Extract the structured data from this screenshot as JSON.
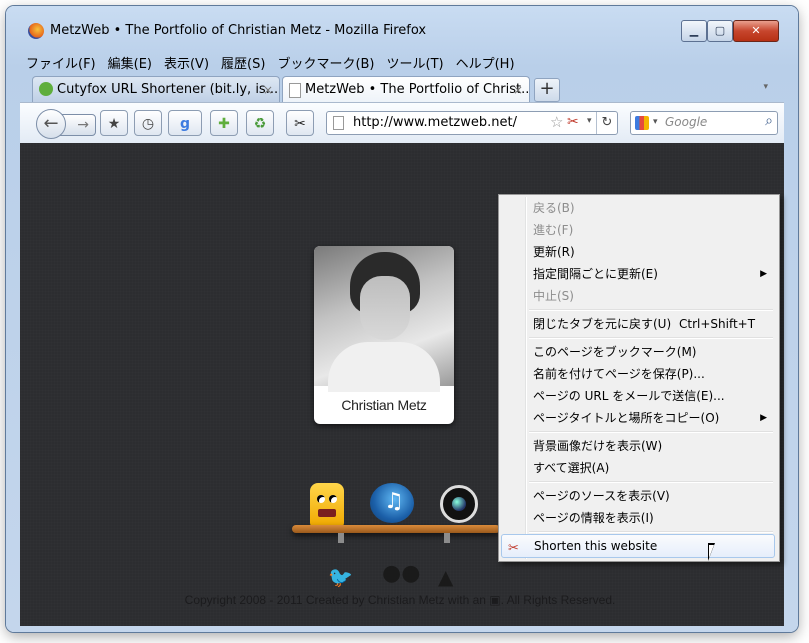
{
  "window": {
    "title": "MetzWeb • The Portfolio of Christian Metz - Mozilla Firefox",
    "min": "▁",
    "max": "▢",
    "close": "✕"
  },
  "menubar": [
    "ファイル(F)",
    "編集(E)",
    "表示(V)",
    "履歴(S)",
    "ブックマーク(B)",
    "ツール(T)",
    "ヘルプ(H)"
  ],
  "tabs": [
    {
      "label": "Cutyfox URL Shortener (bit.ly, is....",
      "close": "×"
    },
    {
      "label": "MetzWeb • The Portfolio of Christ...",
      "close": "×"
    }
  ],
  "newtab": "+",
  "tabs_list": "▾",
  "toolbar": {
    "back": "←",
    "forward": "→",
    "url": "http://www.metzweb.net/",
    "search_placeholder": "Google",
    "reload": "↻",
    "star": "☆",
    "scissors": "✂",
    "dd": "▾",
    "icons": [
      "bookmarks-icon",
      "history-icon",
      "google-icon",
      "addon-icon",
      "recycle-icon",
      "scissors-icon"
    ]
  },
  "page": {
    "name": "Christian Metz",
    "footer": "Copyright 2008 - 2011 Created by Christian Metz with an ▣. All Rights Reserved.",
    "social": [
      "twitter-icon",
      "flickr-icon",
      "tree-icon"
    ]
  },
  "context_menu": {
    "items": [
      {
        "label": "戻る(B)",
        "disabled": true
      },
      {
        "label": "進む(F)",
        "disabled": true
      },
      {
        "label": "更新(R)",
        "disabled": false
      },
      {
        "label": "指定間隔ごとに更新(E)",
        "disabled": false,
        "submenu": "▶"
      },
      {
        "label": "中止(S)",
        "disabled": true
      },
      {
        "label": "閉じたタブを元に戻す(U)",
        "shortcut": "Ctrl+Shift+T"
      },
      {
        "label": "このページをブックマーク(M)"
      },
      {
        "label": "名前を付けてページを保存(P)..."
      },
      {
        "label": "ページの URL をメールで送信(E)..."
      },
      {
        "label": "ページタイトルと場所をコピー(O)",
        "submenu": "▶"
      },
      {
        "label": "背景画像だけを表示(W)"
      },
      {
        "label": "すべて選択(A)"
      },
      {
        "label": "ページのソースを表示(V)"
      },
      {
        "label": "ページの情報を表示(I)"
      },
      {
        "label": "Shorten this website",
        "highlighted": true
      }
    ]
  }
}
